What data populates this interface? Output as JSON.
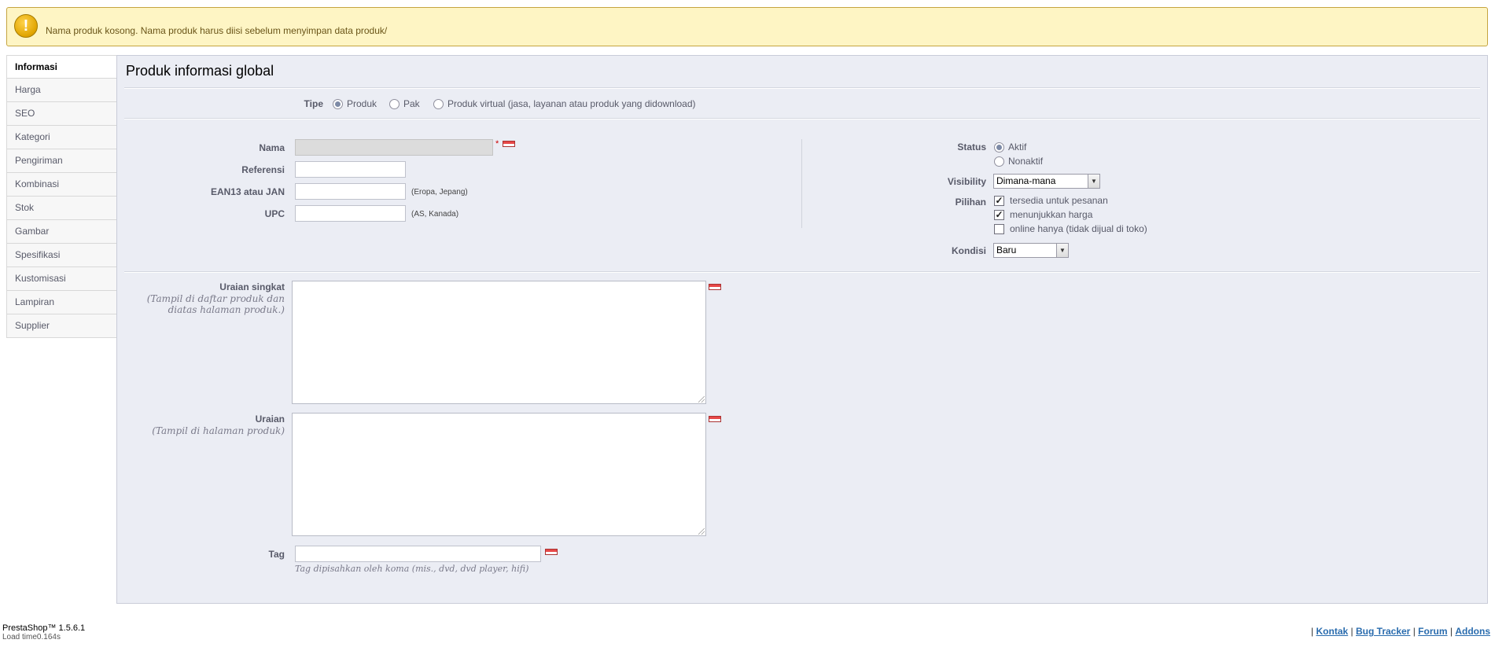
{
  "alert": {
    "message": "Nama produk kosong. Nama produk harus diisi sebelum menyimpan data produk/",
    "icon": "warning-icon"
  },
  "tabs": [
    {
      "label": "Informasi",
      "active": true
    },
    {
      "label": "Harga"
    },
    {
      "label": "SEO"
    },
    {
      "label": "Kategori"
    },
    {
      "label": "Pengiriman"
    },
    {
      "label": "Kombinasi"
    },
    {
      "label": "Stok"
    },
    {
      "label": "Gambar"
    },
    {
      "label": "Spesifikasi"
    },
    {
      "label": "Kustomisasi"
    },
    {
      "label": "Lampiran"
    },
    {
      "label": "Supplier"
    }
  ],
  "panel": {
    "title": "Produk informasi global"
  },
  "type": {
    "label": "Tipe",
    "options": [
      "Produk",
      "Pak",
      "Produk virtual (jasa, layanan atau produk yang didownload)"
    ],
    "selected": "Produk"
  },
  "fields": {
    "name": {
      "label": "Nama",
      "value": "",
      "required_mark": "*"
    },
    "reference": {
      "label": "Referensi",
      "value": ""
    },
    "ean13": {
      "label": "EAN13 atau JAN",
      "value": "",
      "hint": "(Eropa, Jepang)"
    },
    "upc": {
      "label": "UPC",
      "value": "",
      "hint": "(AS, Kanada)"
    }
  },
  "status": {
    "label": "Status",
    "options": [
      "Aktif",
      "Nonaktif"
    ],
    "selected": "Aktif"
  },
  "visibility": {
    "label": "Visibility",
    "value": "Dimana-mana"
  },
  "options": {
    "label": "Pilihan",
    "items": [
      {
        "label": "tersedia untuk pesanan",
        "checked": true
      },
      {
        "label": "menunjukkan harga",
        "checked": true
      },
      {
        "label": "online hanya (tidak dijual di toko)",
        "checked": false
      }
    ]
  },
  "condition": {
    "label": "Kondisi",
    "value": "Baru"
  },
  "short_description": {
    "label": "Uraian singkat",
    "sublabel": "(Tampil di daftar produk dan diatas halaman produk.)"
  },
  "description": {
    "label": "Uraian",
    "sublabel": "(Tampil di halaman produk)"
  },
  "tags": {
    "label": "Tag",
    "value": "",
    "hint": "Tag dipisahkan oleh koma (mis., dvd, dvd player, hifi)"
  },
  "footer": {
    "version": "PrestaShop™ 1.5.6.1",
    "load_time": "Load time0.164s",
    "links": [
      "Kontak",
      "Bug Tracker",
      "Forum",
      "Addons"
    ],
    "separator": "|"
  }
}
